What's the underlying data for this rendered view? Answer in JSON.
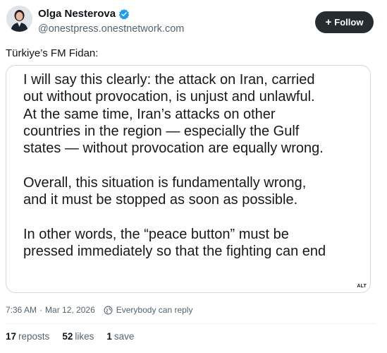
{
  "author": {
    "name": "Olga Nesterova",
    "handle": "@onestpress.onestnetwork.com",
    "avatar_icon": "profile-photo",
    "verified_icon": "verified-check-icon",
    "verified_color": "#1d9bf0"
  },
  "follow_button": {
    "icon": "plus-icon",
    "label": "Follow"
  },
  "post": {
    "text": "Türkiye’s FM Fidan:",
    "media": {
      "lines_1": [
        "I will say this clearly: the attack on Iran, carried",
        "out without provocation, is unjust and unlawful.",
        "At the same time, Iran’s attacks on other",
        "countries in the region — especially the Gulf",
        "states — without provocation are equally wrong."
      ],
      "lines_2": [
        "Overall, this situation is fundamentally wrong,",
        "and it must be stopped as soon as possible."
      ],
      "lines_3": [
        "In other words, the “peace button” must be",
        "pressed immediately so that the fighting can end"
      ],
      "alt_badge": "ALT"
    }
  },
  "meta": {
    "time": "7:36 AM",
    "separator": "·",
    "date": "Mar 12, 2026",
    "reply_icon": "globe-icon",
    "reply_scope": "Everybody can reply"
  },
  "stats": {
    "reposts_count": "17",
    "reposts_label": "reposts",
    "likes_count": "52",
    "likes_label": "likes",
    "saves_count": "1",
    "saves_label": "save"
  },
  "colors": {
    "text_primary": "#0f1419",
    "text_secondary": "#536471",
    "button_bg": "#272c30",
    "border": "#cfd9de"
  }
}
